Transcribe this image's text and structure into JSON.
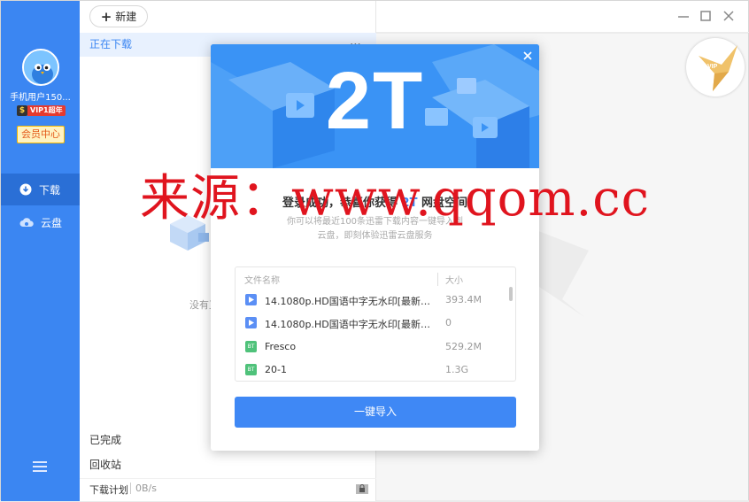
{
  "user": {
    "name": "手机用户150...",
    "vip_badge": "VIP1超年",
    "vip_level": "1",
    "member_center": "会员中心"
  },
  "sidebar": {
    "items": [
      {
        "label": "下载",
        "icon": "download-icon"
      },
      {
        "label": "云盘",
        "icon": "cloud-icon"
      }
    ]
  },
  "toolbar": {
    "new_label": "新建"
  },
  "downloads": {
    "downloading_label": "正在下载",
    "empty_text": "没有正",
    "completed_label": "已完成",
    "recycle_label": "回收站",
    "plan_label": "下载计划",
    "speed": "0B/s"
  },
  "modal": {
    "banner_text": "2T",
    "title_prefix": "登录成功，恭喜你获得",
    "title_highlight": "2T",
    "title_suffix": "网盘空间",
    "subtitle_line1": "你可以将最近100条迅雷下载内容一键导入到",
    "subtitle_line2": "云盘，即刻体验迅雷云盘服务",
    "table": {
      "col_name": "文件名称",
      "col_size": "大小",
      "rows": [
        {
          "name": "14.1080p.HD国语中字无水印[最新电...",
          "size": "393.4M",
          "icon": "video"
        },
        {
          "name": "14.1080p.HD国语中字无水印[最新电...",
          "size": "0",
          "icon": "video"
        },
        {
          "name": "Fresco",
          "size": "529.2M",
          "icon": "bt"
        },
        {
          "name": "20-1",
          "size": "1.3G",
          "icon": "bt"
        }
      ]
    },
    "import_button": "一键导入"
  },
  "watermark": "来源：www.qqom.cc",
  "colors": {
    "brand_blue": "#3b86f2",
    "vip_red": "#e63a2e",
    "watermark_red": "#e0141e"
  }
}
